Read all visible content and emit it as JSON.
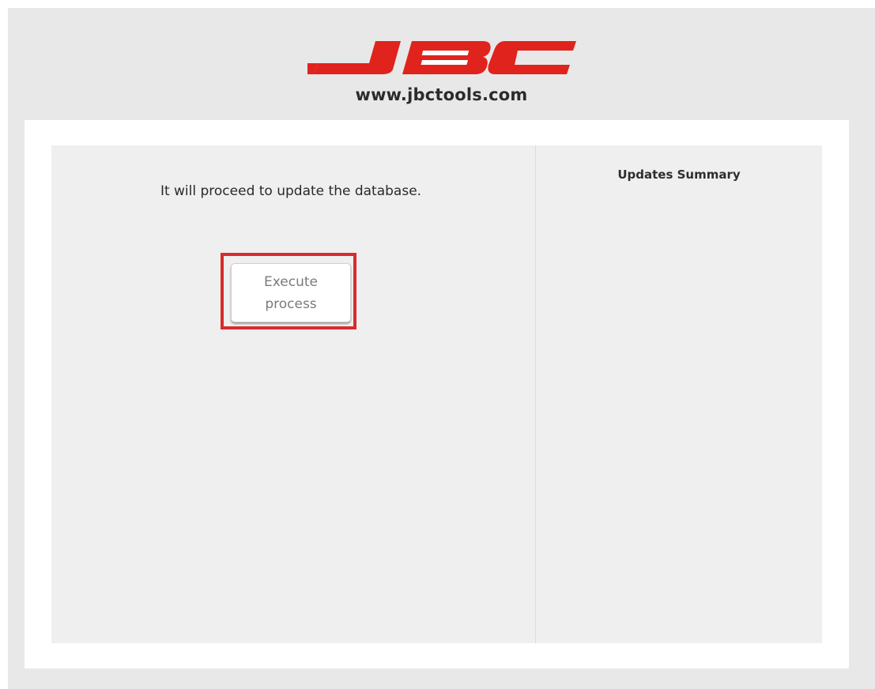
{
  "header": {
    "logo_text": "JBC",
    "url": "www.jbctools.com"
  },
  "main": {
    "message": "It will proceed to update the database.",
    "execute_button": {
      "line1": "Execute",
      "line2": "process"
    }
  },
  "summary": {
    "title": "Updates Summary"
  },
  "colors": {
    "brand_red": "#e0231c",
    "highlight_red": "#d92b2b",
    "panel_bg": "#efefef",
    "page_bg": "#e8e8e8"
  }
}
